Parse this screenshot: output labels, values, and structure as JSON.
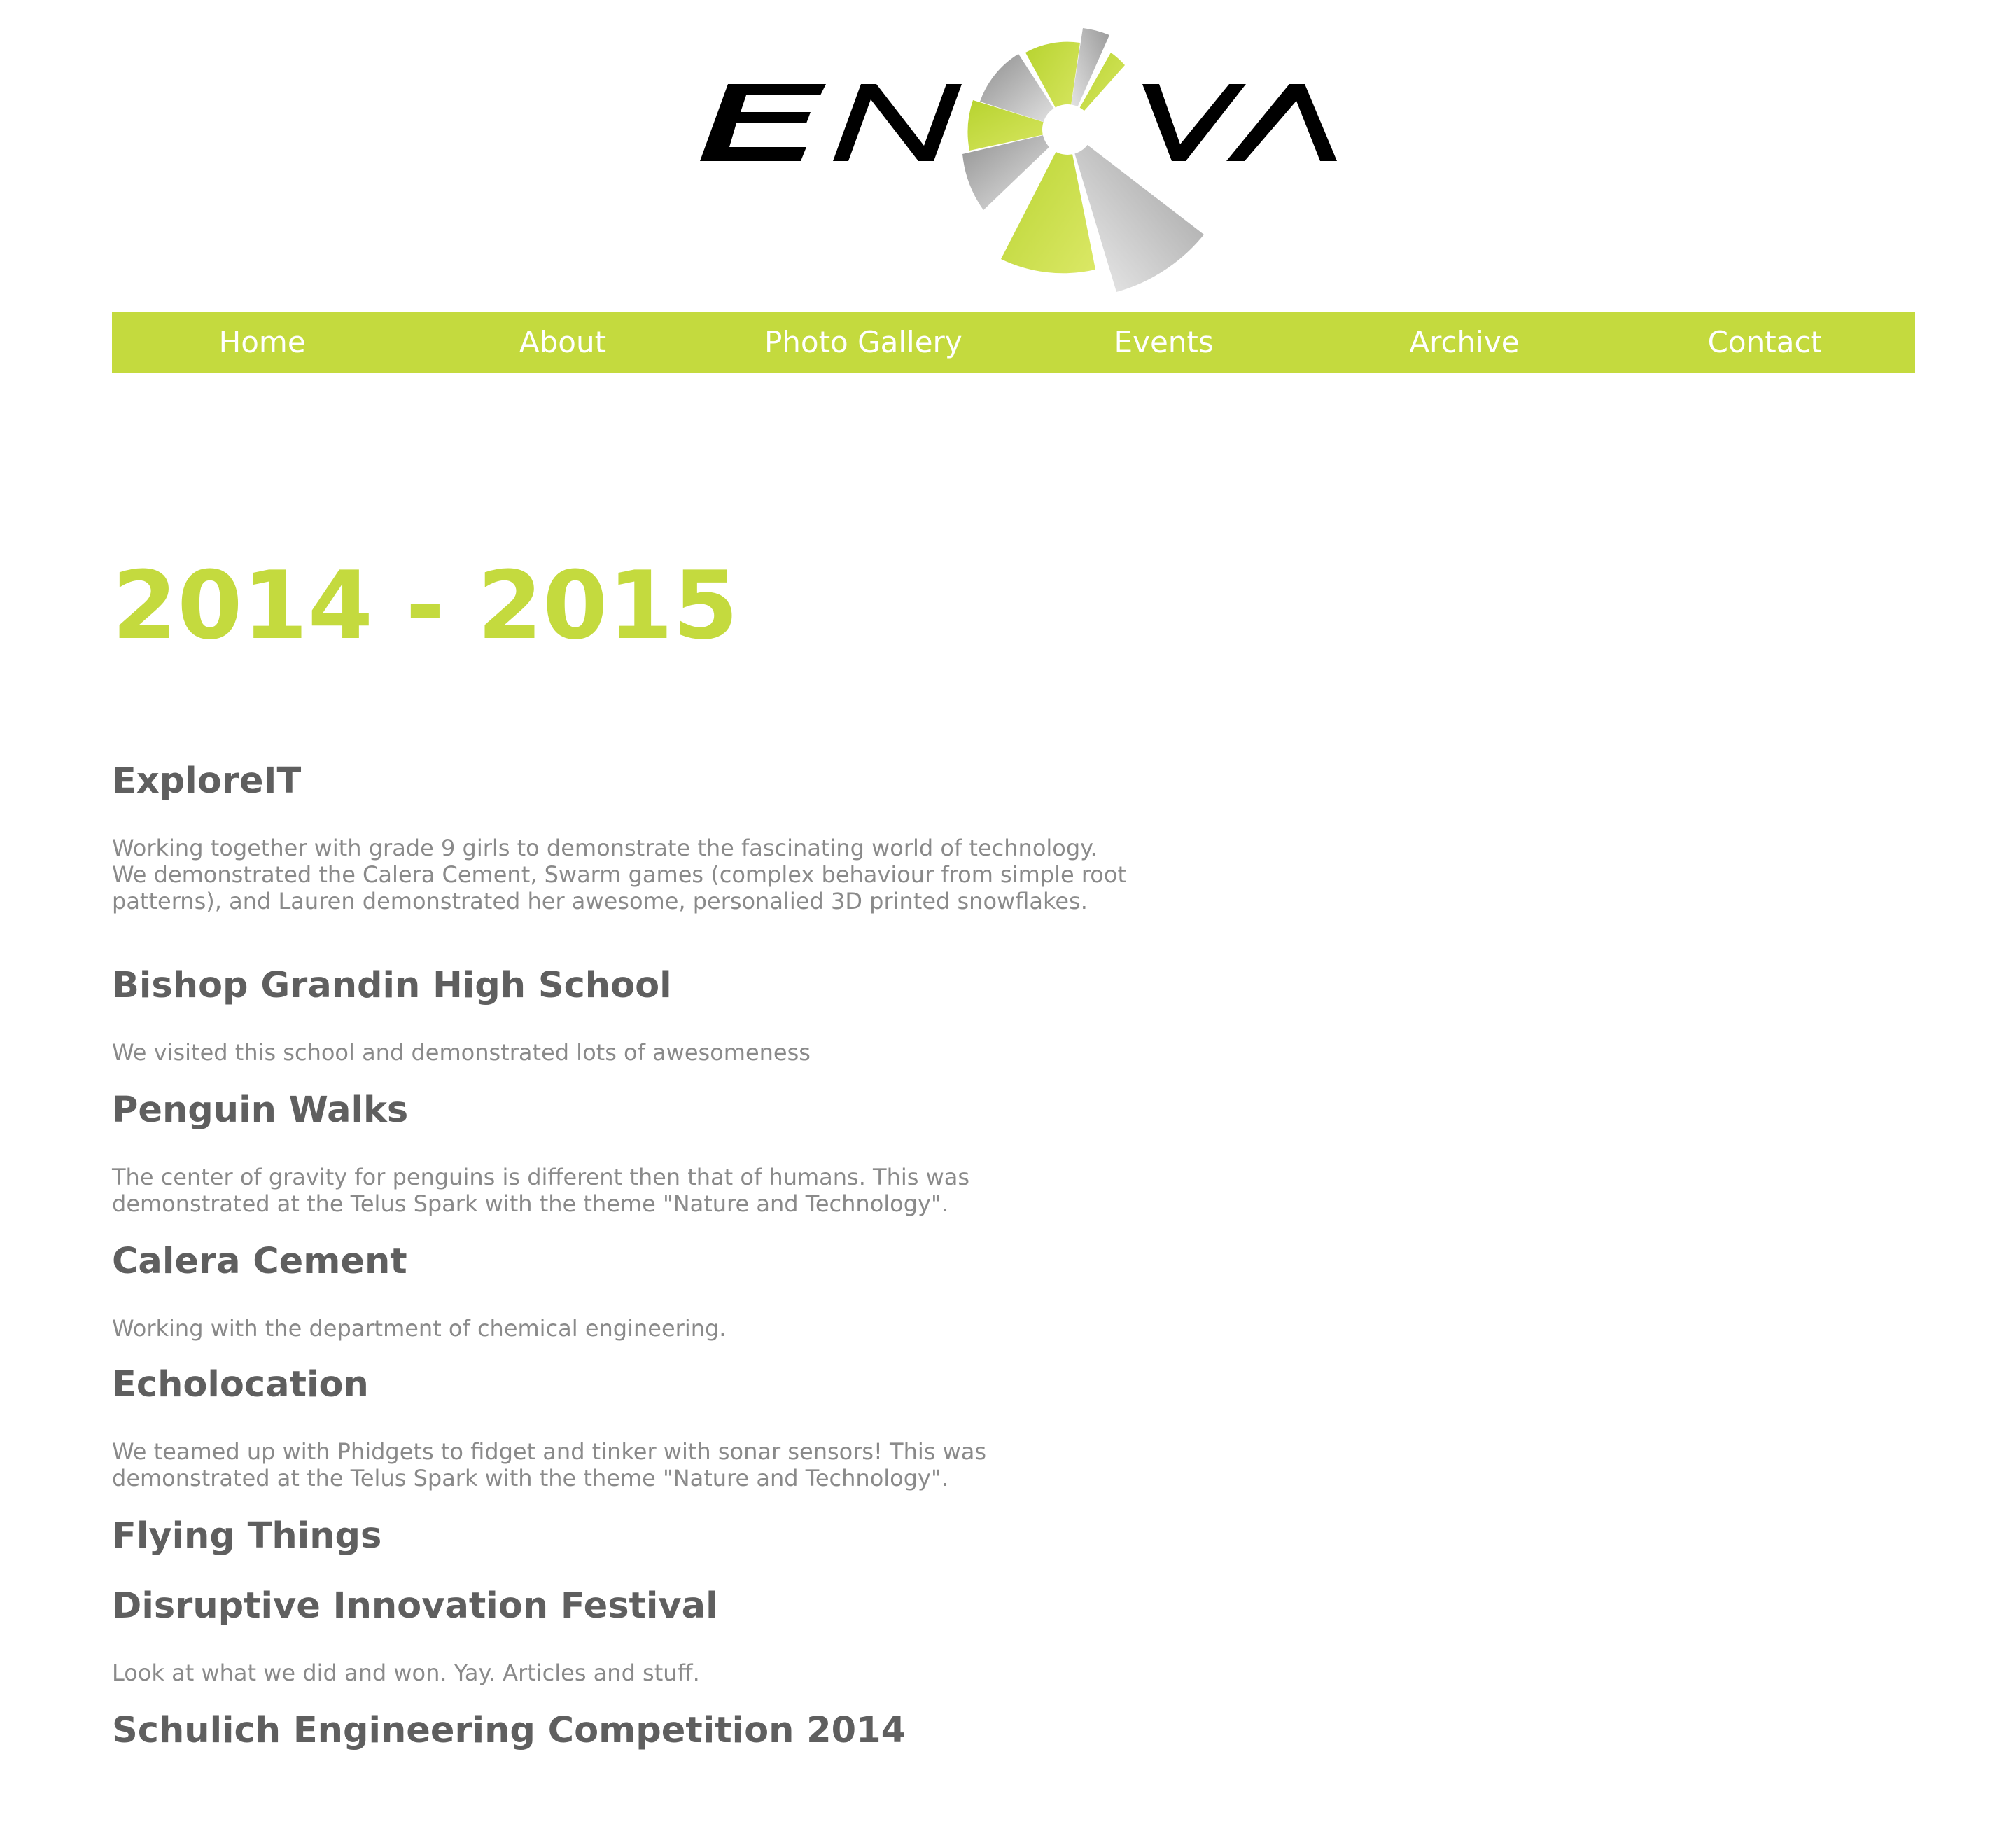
{
  "logo": {
    "letters_left": "EN",
    "letters_right": "VA",
    "brand_green": "#c4da3e",
    "alt": "ENOVA"
  },
  "nav": {
    "items": [
      {
        "label": "Home"
      },
      {
        "label": "About"
      },
      {
        "label": "Photo Gallery"
      },
      {
        "label": "Events"
      },
      {
        "label": "Archive"
      },
      {
        "label": "Contact"
      }
    ],
    "background": "#c4da3e",
    "text_color": "#ffffff"
  },
  "main": {
    "title": "2014 - 2015",
    "events": [
      {
        "title": "ExploreIT",
        "description": "Working together with grade 9 girls to demonstrate the fascinating world of technology. We demonstrated the Calera Cement, Swarm games (complex behaviour from simple root patterns), and Lauren demonstrated her awesome, personalied 3D printed snowflakes."
      },
      {
        "title": "Bishop Grandin High School",
        "description": "We visited this school and demonstrated lots of awesomeness"
      },
      {
        "title": "Penguin Walks",
        "description": "The center of gravity for penguins is different then that of humans. This was demonstrated at the Telus Spark with the theme \"Nature and Technology\"."
      },
      {
        "title": "Calera Cement",
        "description": "Working with the department of chemical engineering."
      },
      {
        "title": "Echolocation",
        "description": "We teamed up with Phidgets to fidget and tinker with sonar sensors! This was demonstrated at the Telus Spark with the theme \"Nature and Technology\"."
      },
      {
        "title": "Flying Things",
        "description": ""
      },
      {
        "title": "Disruptive Innovation Festival",
        "description": "Look at what we did and won. Yay. Articles and stuff."
      },
      {
        "title": "Schulich Engineering Competition 2014",
        "description": ""
      }
    ]
  }
}
